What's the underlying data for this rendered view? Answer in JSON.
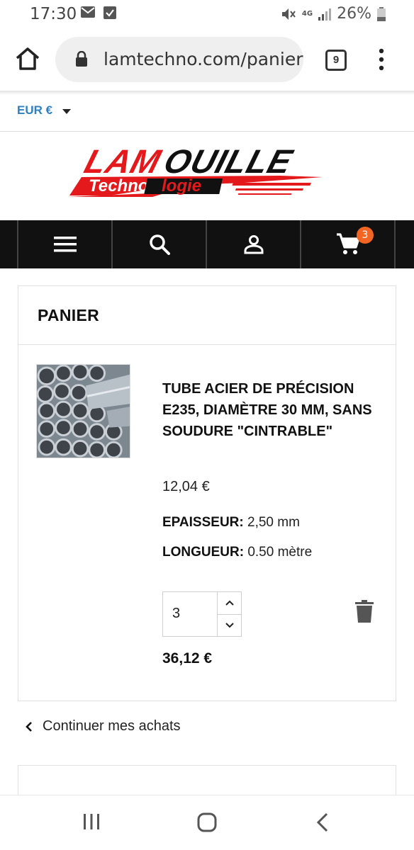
{
  "status_bar": {
    "time": "17:30",
    "battery": "26%",
    "network": "4G"
  },
  "browser": {
    "url": "lamtechno.com/panier",
    "tab_count": "9"
  },
  "shop": {
    "currency": "EUR €",
    "logo_line1": "LAMOUILLE",
    "logo_line2": "Technologie",
    "logo_colors": {
      "red": "#e3191b",
      "black": "#111111"
    },
    "nav": {
      "menu_icon": "hamburger-icon",
      "search_icon": "search-icon",
      "account_icon": "user-icon",
      "cart_icon": "cart-icon",
      "cart_count": "3",
      "badge_color": "#f26522"
    }
  },
  "cart": {
    "title": "PANIER",
    "item": {
      "name": "TUBE ACIER DE PRÉCISION E235, DIAMÈTRE 30 MM, SANS SOUDURE \"CINTRABLE\"",
      "price": "12,04 €",
      "attributes": [
        {
          "label": "EPAISSEUR:",
          "value": " 2,50 mm"
        },
        {
          "label": "LONGUEUR:",
          "value": " 0.50 mètre"
        }
      ],
      "quantity": "3",
      "line_total": "36,12 €"
    },
    "continue_label": "Continuer mes achats"
  },
  "colors": {
    "accent_blue": "#2f7fc1",
    "nav_bg": "#111111"
  }
}
